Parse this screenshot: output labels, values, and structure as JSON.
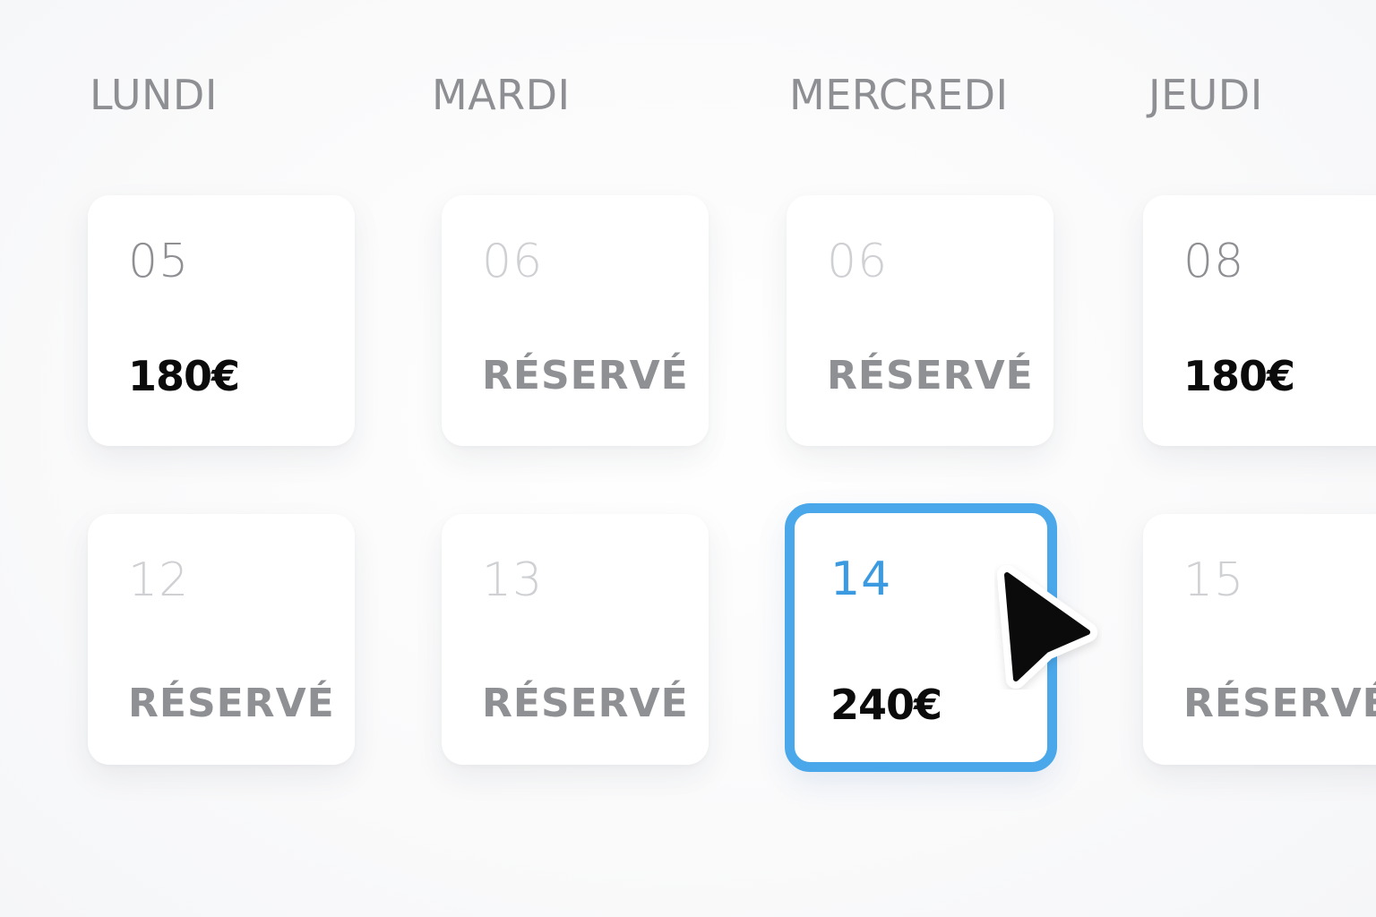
{
  "days": [
    "LUNDI",
    "MARDI",
    "MERCREDI",
    "JEUDI"
  ],
  "row1": [
    {
      "date": "05",
      "value": "180€",
      "state": "available"
    },
    {
      "date": "06",
      "value": "RÉSERVÉ",
      "state": "reserved"
    },
    {
      "date": "06",
      "value": "RÉSERVÉ",
      "state": "reserved"
    },
    {
      "date": "08",
      "value": "180€",
      "state": "available"
    }
  ],
  "row2": [
    {
      "date": "12",
      "value": "RÉSERVÉ",
      "state": "reserved"
    },
    {
      "date": "13",
      "value": "RÉSERVÉ",
      "state": "reserved"
    },
    {
      "date": "14",
      "value": "240€",
      "state": "selected"
    },
    {
      "date": "15",
      "value": "RÉSERVÉ",
      "state": "reserved"
    }
  ],
  "colors": {
    "accent": "#4aa7ea",
    "header_text": "#8e8f93",
    "muted_date": "#cfd0d3",
    "price_text": "#0b0b0c"
  },
  "icons": {
    "cursor": "mouse-pointer-icon"
  }
}
